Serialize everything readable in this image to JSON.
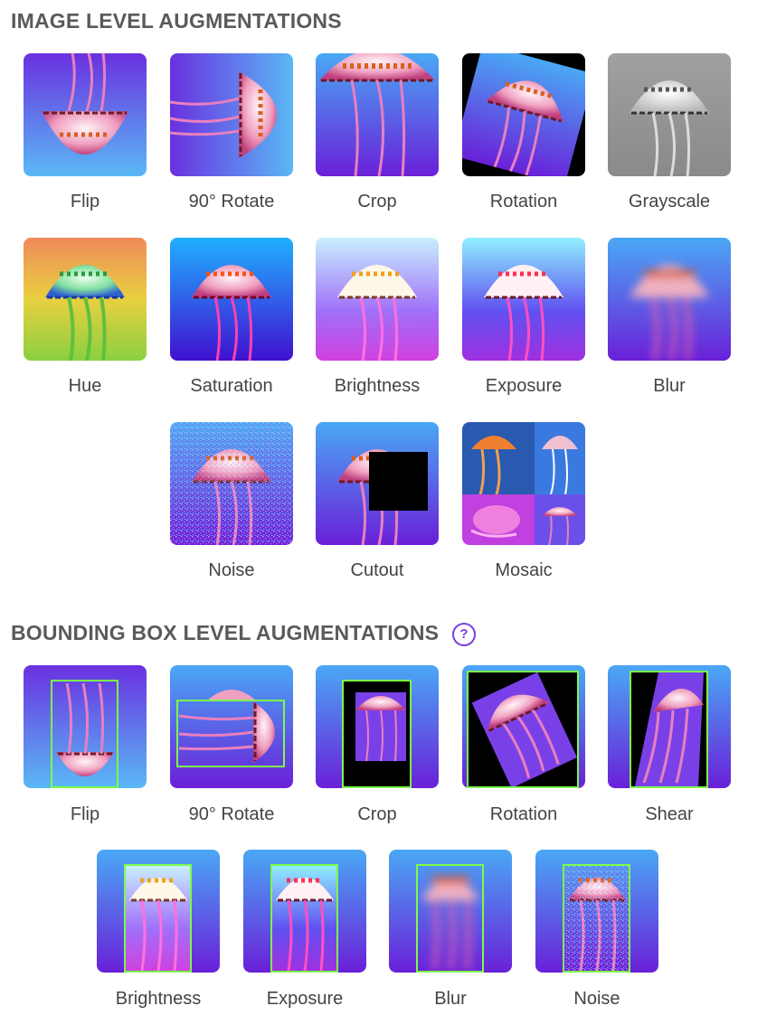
{
  "image_level": {
    "title": "IMAGE LEVEL AUGMENTATIONS",
    "items": [
      {
        "label": "Flip",
        "icon": "flip-image"
      },
      {
        "label": "90° Rotate",
        "icon": "rotate-90-image"
      },
      {
        "label": "Crop",
        "icon": "crop-image"
      },
      {
        "label": "Rotation",
        "icon": "rotation-image"
      },
      {
        "label": "Grayscale",
        "icon": "grayscale-image"
      },
      {
        "label": "Hue",
        "icon": "hue-image"
      },
      {
        "label": "Saturation",
        "icon": "saturation-image"
      },
      {
        "label": "Brightness",
        "icon": "brightness-image"
      },
      {
        "label": "Exposure",
        "icon": "exposure-image"
      },
      {
        "label": "Blur",
        "icon": "blur-image"
      },
      {
        "label": "Noise",
        "icon": "noise-image"
      },
      {
        "label": "Cutout",
        "icon": "cutout-image"
      },
      {
        "label": "Mosaic",
        "icon": "mosaic-image"
      }
    ]
  },
  "bbox_level": {
    "title": "BOUNDING BOX LEVEL AUGMENTATIONS",
    "help_icon": "?",
    "items": [
      {
        "label": "Flip",
        "icon": "bbox-flip-image"
      },
      {
        "label": "90° Rotate",
        "icon": "bbox-rotate-90-image"
      },
      {
        "label": "Crop",
        "icon": "bbox-crop-image"
      },
      {
        "label": "Rotation",
        "icon": "bbox-rotation-image"
      },
      {
        "label": "Shear",
        "icon": "bbox-shear-image"
      },
      {
        "label": "Brightness",
        "icon": "bbox-brightness-image"
      },
      {
        "label": "Exposure",
        "icon": "bbox-exposure-image"
      },
      {
        "label": "Blur",
        "icon": "bbox-blur-image"
      },
      {
        "label": "Noise",
        "icon": "bbox-noise-image"
      }
    ]
  },
  "colors": {
    "title": "#5a5a5a",
    "help_accent": "#7b3fe4",
    "bbox_outline": "#7CFC4A",
    "bg_top": "#3aa0f0",
    "bg_bottom": "#6a1fd6"
  }
}
